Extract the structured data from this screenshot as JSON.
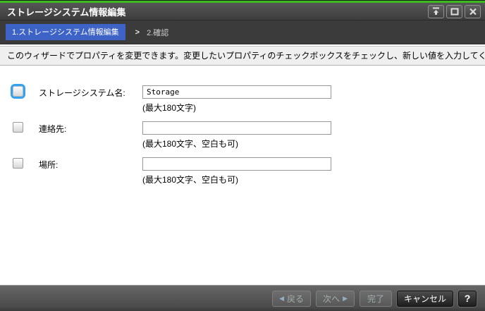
{
  "window": {
    "title": "ストレージシステム情報編集",
    "controls": [
      "collapse-to-top-icon",
      "maximize-icon",
      "close-icon"
    ]
  },
  "breadcrumb": {
    "separator": ">",
    "steps": [
      {
        "label": "1.ストレージシステム情報編集",
        "active": true
      },
      {
        "label": "2.確認",
        "active": false
      }
    ]
  },
  "instruction": "このウィザードでプロパティを変更できます。変更したいプロパティのチェックボックスをチェックし、新しい値を入力してください。",
  "form": {
    "fields": [
      {
        "label": "ストレージシステム名:",
        "value": "Storage",
        "hint": "(最大180文字)",
        "checked": false,
        "focused": true
      },
      {
        "label": "連絡先:",
        "value": "",
        "hint": "(最大180文字、空白も可)",
        "checked": false,
        "focused": false
      },
      {
        "label": "場所:",
        "value": "",
        "hint": "(最大180文字、空白も可)",
        "checked": false,
        "focused": false
      }
    ]
  },
  "footer": {
    "back_arrow": "◀",
    "back_label": "戻る",
    "next_label": "次へ",
    "next_arrow": "▶",
    "finish_label": "完了",
    "cancel_label": "キャンセル",
    "help_label": "?"
  },
  "colors": {
    "accent_green": "#3dbb1e",
    "titlebar_dark": "#3d3d3d",
    "breadcrumb_bg": "#3b3b3b",
    "step_active_blue": "#3e63c6",
    "focus_ring_blue": "#35a2ef",
    "footer_dark": "#4a4a4a"
  }
}
